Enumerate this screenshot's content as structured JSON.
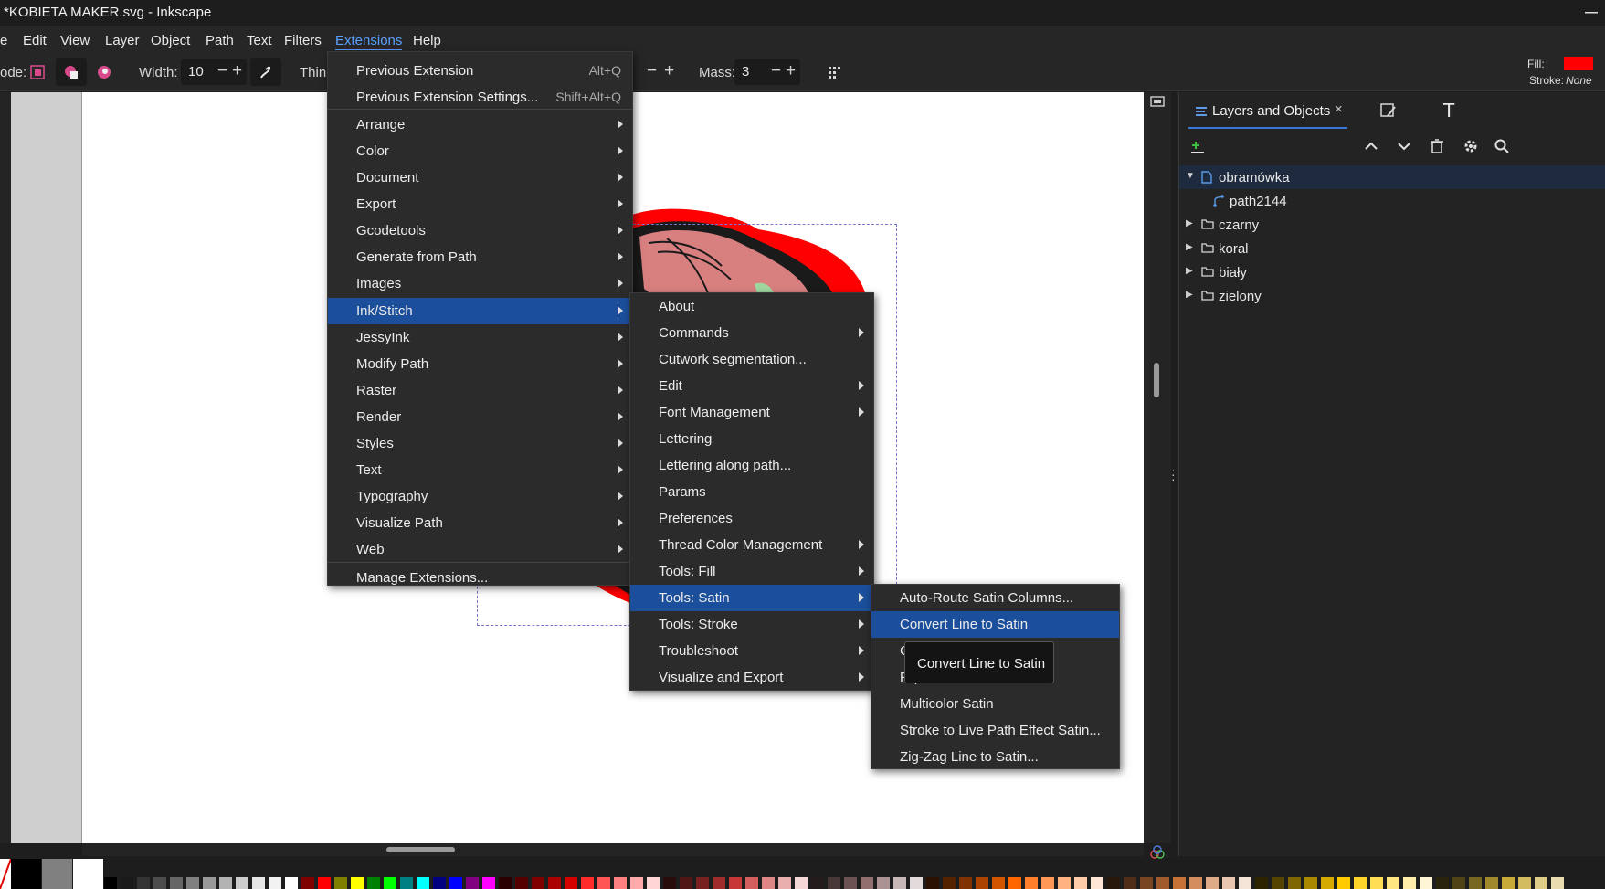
{
  "window": {
    "title": "*KOBIETA MAKER.svg - Inkscape"
  },
  "menubar": {
    "items": [
      "e",
      "Edit",
      "View",
      "Layer",
      "Object",
      "Path",
      "Text",
      "Filters",
      "Extensions",
      "Help"
    ],
    "active": "Extensions"
  },
  "toolbar": {
    "mode_label": "ode:",
    "width_label": "Width:",
    "width_value": "10",
    "thinning_label": "Thin",
    "mass_label": "Mass:",
    "mass_value": "3"
  },
  "fill_stroke": {
    "fill_label": "Fill:",
    "fill_color": "#ff0000",
    "stroke_label": "Stroke:",
    "stroke_value": "None"
  },
  "extensions_menu": {
    "items": [
      {
        "label": "Previous Extension",
        "shortcut": "Alt+Q"
      },
      {
        "label": "Previous Extension Settings...",
        "shortcut": "Shift+Alt+Q"
      },
      {
        "label": "Arrange",
        "submenu": true
      },
      {
        "label": "Color",
        "submenu": true
      },
      {
        "label": "Document",
        "submenu": true
      },
      {
        "label": "Export",
        "submenu": true
      },
      {
        "label": "Gcodetools",
        "submenu": true
      },
      {
        "label": "Generate from Path",
        "submenu": true
      },
      {
        "label": "Images",
        "submenu": true
      },
      {
        "label": "Ink/Stitch",
        "submenu": true,
        "highlighted": true
      },
      {
        "label": "JessyInk",
        "submenu": true
      },
      {
        "label": "Modify Path",
        "submenu": true
      },
      {
        "label": "Raster",
        "submenu": true
      },
      {
        "label": "Render",
        "submenu": true
      },
      {
        "label": "Styles",
        "submenu": true
      },
      {
        "label": "Text",
        "submenu": true
      },
      {
        "label": "Typography",
        "submenu": true
      },
      {
        "label": "Visualize Path",
        "submenu": true
      },
      {
        "label": "Web",
        "submenu": true
      },
      {
        "label": "Manage Extensions..."
      }
    ]
  },
  "inkstitch_menu": {
    "items": [
      {
        "label": "About"
      },
      {
        "label": "Commands",
        "submenu": true
      },
      {
        "label": "Cutwork segmentation..."
      },
      {
        "label": "Edit",
        "submenu": true
      },
      {
        "label": "Font Management",
        "submenu": true
      },
      {
        "label": "Lettering"
      },
      {
        "label": "Lettering along path..."
      },
      {
        "label": "Params"
      },
      {
        "label": "Preferences"
      },
      {
        "label": "Thread Color Management",
        "submenu": true
      },
      {
        "label": "Tools: Fill",
        "submenu": true
      },
      {
        "label": "Tools: Satin",
        "submenu": true,
        "highlighted": true
      },
      {
        "label": "Tools: Stroke",
        "submenu": true
      },
      {
        "label": "Troubleshoot",
        "submenu": true
      },
      {
        "label": "Visualize and Export",
        "submenu": true
      }
    ]
  },
  "satin_menu": {
    "items": [
      {
        "label": "Auto-Route Satin Columns..."
      },
      {
        "label": "Convert Line to Satin",
        "highlighted": true
      },
      {
        "label": "Cut Satin Column"
      },
      {
        "label": "Flip Satin Column Rails"
      },
      {
        "label": "Multicolor Satin"
      },
      {
        "label": "Stroke to Live Path Effect Satin..."
      },
      {
        "label": "Zig-Zag Line to Satin..."
      }
    ]
  },
  "tooltip": {
    "text": "Convert Line to Satin"
  },
  "layers_panel": {
    "tab_label": "Layers and Objects",
    "close_glyph": "×",
    "tree": [
      {
        "name": "obramówka",
        "expanded": true,
        "selected": true,
        "type": "layer"
      },
      {
        "name": "path2144",
        "type": "path",
        "indent": 1
      },
      {
        "name": "czarny",
        "type": "layer"
      },
      {
        "name": "koral",
        "type": "layer"
      },
      {
        "name": "biały",
        "type": "layer"
      },
      {
        "name": "zielony",
        "type": "layer"
      }
    ]
  },
  "palette": {
    "colors": [
      "#000000",
      "#1a1a1a",
      "#333333",
      "#4d4d4d",
      "#666666",
      "#808080",
      "#999999",
      "#b3b3b3",
      "#cccccc",
      "#e6e6e6",
      "#f2f2f2",
      "#ffffff",
      "#800000",
      "#ff0000",
      "#808000",
      "#ffff00",
      "#008000",
      "#00ff00",
      "#008080",
      "#00ffff",
      "#000080",
      "#0000ff",
      "#800080",
      "#ff00ff",
      "#2b0000",
      "#550000",
      "#800000",
      "#aa0000",
      "#d40000",
      "#ff2a2a",
      "#ff5555",
      "#ff8080",
      "#ffaaaa",
      "#ffd5d5",
      "#280b0b",
      "#501616",
      "#782121",
      "#a02c2c",
      "#c83737",
      "#d35f5f",
      "#de8787",
      "#e9afaf",
      "#f4d7d7",
      "#241c1c",
      "#483737",
      "#6c5353",
      "#916f6f",
      "#ac9393",
      "#c8b7b7",
      "#e3dbdb",
      "#2b1100",
      "#552200",
      "#803300",
      "#aa4400",
      "#d45500",
      "#ff6600",
      "#ff7f2a",
      "#ff9955",
      "#ffb380",
      "#ffccaa",
      "#ffe6d5",
      "#28170b",
      "#502d16",
      "#784421",
      "#a05a2c",
      "#c87137",
      "#d38d5f",
      "#deaa87",
      "#e9c6af",
      "#f4e3d7",
      "#2b2200",
      "#554400",
      "#806600",
      "#aa8800",
      "#d4aa00",
      "#ffcc00",
      "#ffd42a",
      "#ffdd55",
      "#ffe680",
      "#ffeeaa",
      "#fff6d5",
      "#28220b",
      "#504416",
      "#786721",
      "#a0892c",
      "#c8ab37",
      "#d3bc5f",
      "#decd87",
      "#e9ddaf"
    ]
  }
}
